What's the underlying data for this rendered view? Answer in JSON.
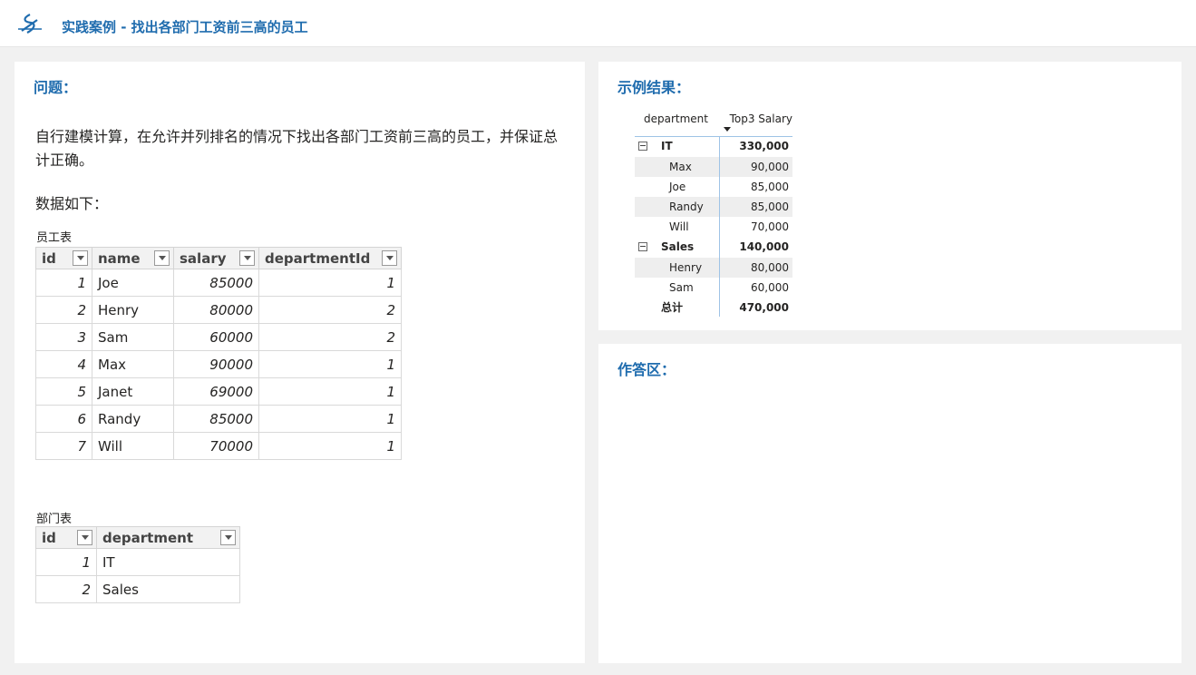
{
  "header": {
    "title": "实践案例 - 找出各部门工资前三高的员工"
  },
  "question": {
    "title": "问题：",
    "text": "自行建模计算，在允许并列排名的情况下找出各部门工资前三高的员工，并保证总计正确。",
    "data_label": "数据如下："
  },
  "employee_table": {
    "caption": "员工表",
    "headers": [
      "id",
      "name",
      "salary",
      "departmentId"
    ],
    "rows": [
      [
        "1",
        "Joe",
        "85000",
        "1"
      ],
      [
        "2",
        "Henry",
        "80000",
        "2"
      ],
      [
        "3",
        "Sam",
        "60000",
        "2"
      ],
      [
        "4",
        "Max",
        "90000",
        "1"
      ],
      [
        "5",
        "Janet",
        "69000",
        "1"
      ],
      [
        "6",
        "Randy",
        "85000",
        "1"
      ],
      [
        "7",
        "Will",
        "70000",
        "1"
      ]
    ]
  },
  "department_table": {
    "caption": "部门表",
    "headers": [
      "id",
      "department"
    ],
    "rows": [
      [
        "1",
        "IT"
      ],
      [
        "2",
        "Sales"
      ]
    ]
  },
  "result": {
    "title": "示例结果：",
    "col1": "department",
    "col2": "Top3 Salary",
    "groups": [
      {
        "name": "IT",
        "total": "330,000",
        "members": [
          {
            "name": "Max",
            "value": "90,000"
          },
          {
            "name": "Joe",
            "value": "85,000"
          },
          {
            "name": "Randy",
            "value": "85,000"
          },
          {
            "name": "Will",
            "value": "70,000"
          }
        ]
      },
      {
        "name": "Sales",
        "total": "140,000",
        "members": [
          {
            "name": "Henry",
            "value": "80,000"
          },
          {
            "name": "Sam",
            "value": "60,000"
          }
        ]
      }
    ],
    "total_label": "总计",
    "total_value": "470,000"
  },
  "answer": {
    "title": "作答区："
  },
  "colors": {
    "accent": "#1f6cae",
    "divider": "#9ec3e6",
    "row_shade": "#eeeeee"
  }
}
